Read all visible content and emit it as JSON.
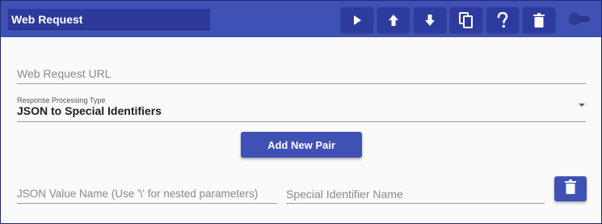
{
  "header": {
    "title_value": "Web Request",
    "buttons": [
      {
        "name": "play-button",
        "icon": "play-icon"
      },
      {
        "name": "move-up-button",
        "icon": "arrow-up-icon"
      },
      {
        "name": "move-down-button",
        "icon": "arrow-down-icon"
      },
      {
        "name": "copy-button",
        "icon": "copy-icon"
      },
      {
        "name": "help-button",
        "icon": "help-icon"
      },
      {
        "name": "delete-button",
        "icon": "trash-icon"
      }
    ],
    "toggle_state": "off"
  },
  "form": {
    "url_placeholder": "Web Request URL",
    "url_value": "",
    "processing_label": "Response Processing Type",
    "processing_value": "JSON to Special Identifiers",
    "add_pair_label": "Add New Pair",
    "pair": {
      "json_name_placeholder": "JSON Value Name (Use '\\' for nested parameters)",
      "special_id_placeholder": "Special Identifier Name"
    }
  },
  "colors": {
    "primary": "#3f51b5",
    "header_button": "#2e3b9e",
    "background": "#fafafa"
  }
}
